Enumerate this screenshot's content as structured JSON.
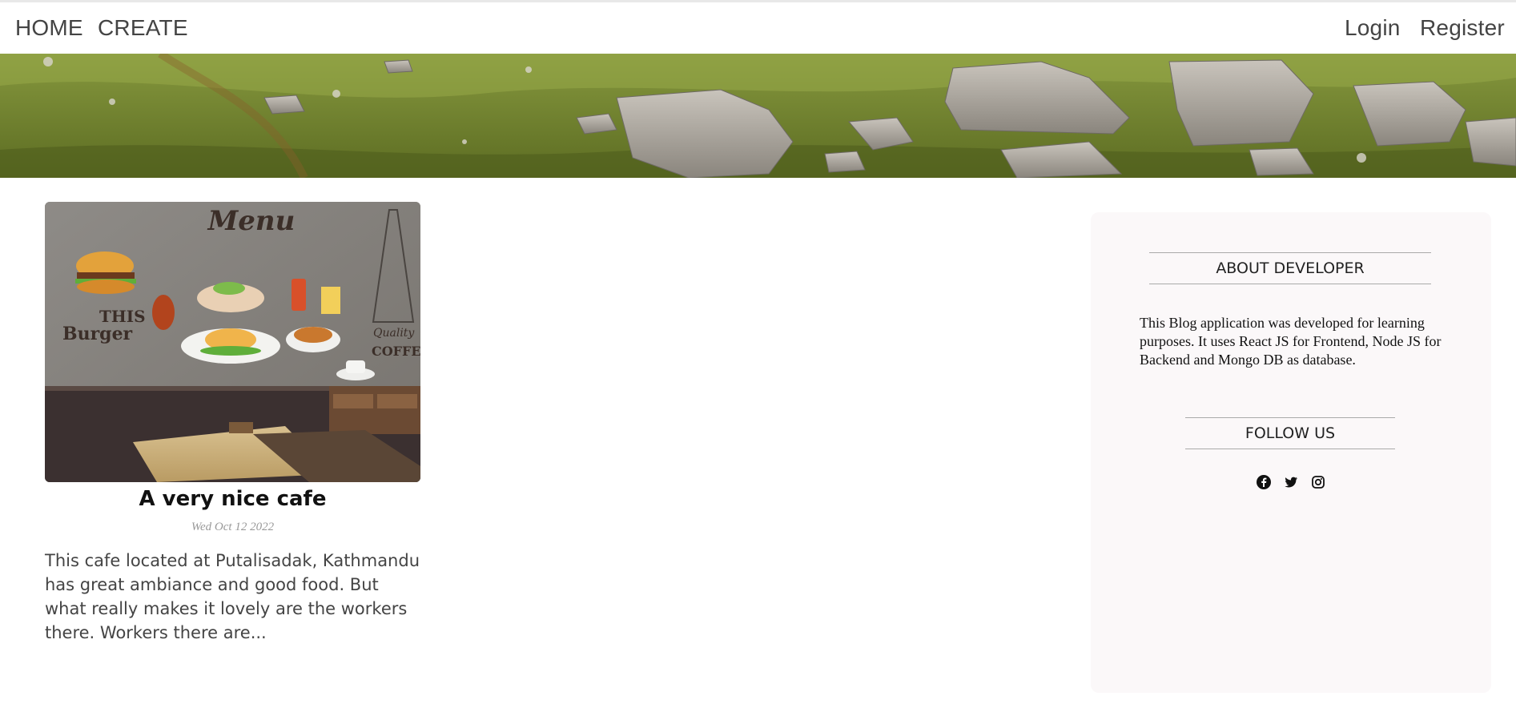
{
  "nav": {
    "left": [
      {
        "label": "HOME"
      },
      {
        "label": "CREATE"
      }
    ],
    "right": [
      {
        "label": "Login"
      },
      {
        "label": "Register"
      }
    ]
  },
  "banner": {
    "image": "rocky-green-hillside-photo"
  },
  "post": {
    "image": "cafe-menu-wall-photo",
    "image_text": {
      "menu": "Menu",
      "this": "THIS",
      "burger": "Burger",
      "quality": "Quality",
      "coffee": "COFFEE"
    },
    "title": "A very nice cafe",
    "date": "Wed Oct 12 2022",
    "excerpt": "This cafe located at Putalisadak, Kathmandu has great ambiance and good food. But what really makes it lovely are the workers there. Workers there are..."
  },
  "sidebar": {
    "about_title": "ABOUT DEVELOPER",
    "about_text": "This Blog application was developed for learning purposes. It uses React JS for Frontend, Node JS for Backend and Mongo DB as database.",
    "follow_title": "FOLLOW US",
    "socials": [
      "facebook-icon",
      "twitter-icon",
      "instagram-icon"
    ]
  }
}
